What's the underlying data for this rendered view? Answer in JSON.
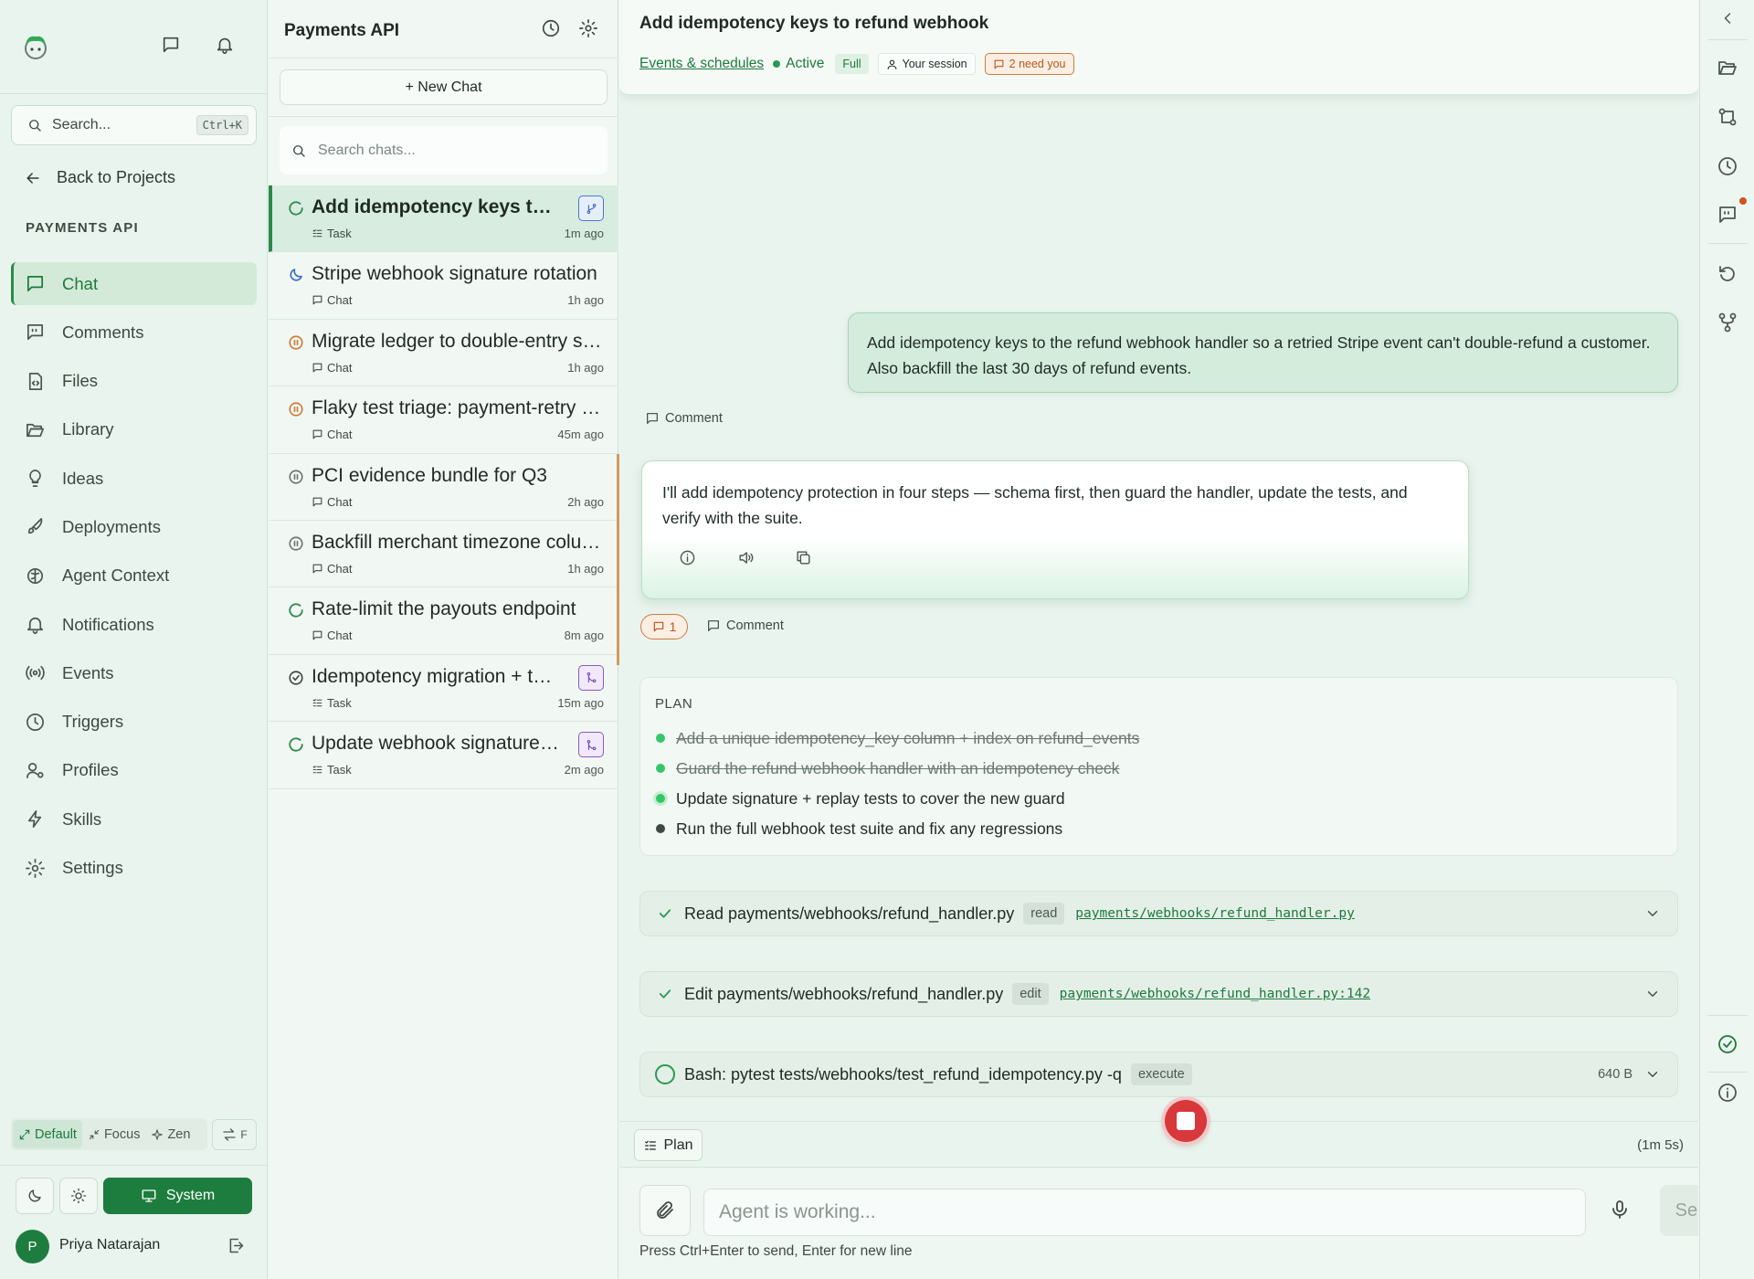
{
  "sidebar": {
    "search_label": "Search...",
    "search_shortcut": "Ctrl+K",
    "back_label": "Back to Projects",
    "project_name": "PAYMENTS API",
    "nav": [
      {
        "label": "Chat",
        "icon": "chat-icon",
        "active": true
      },
      {
        "label": "Comments",
        "icon": "comments-icon"
      },
      {
        "label": "Files",
        "icon": "file-code-icon"
      },
      {
        "label": "Library",
        "icon": "folder-open-icon"
      },
      {
        "label": "Ideas",
        "icon": "lightbulb-icon"
      },
      {
        "label": "Deployments",
        "icon": "rocket-icon"
      },
      {
        "label": "Agent Context",
        "icon": "brain-icon"
      },
      {
        "label": "Notifications",
        "icon": "bell-icon"
      },
      {
        "label": "Events",
        "icon": "broadcast-icon"
      },
      {
        "label": "Triggers",
        "icon": "clock-icon"
      },
      {
        "label": "Profiles",
        "icon": "user-gear-icon"
      },
      {
        "label": "Skills",
        "icon": "lightning-icon"
      },
      {
        "label": "Settings",
        "icon": "gear-icon"
      }
    ],
    "layout_modes": [
      "Default",
      "Focus",
      "Zen"
    ],
    "layout_active": "Default",
    "swap_label": "F",
    "theme_system_label": "System",
    "user": {
      "initial": "P",
      "name": "Priya Natarajan"
    }
  },
  "chatlist": {
    "title": "Payments API",
    "new_chat_label": "+ New Chat",
    "search_placeholder": "Search chats...",
    "items": [
      {
        "title": "Add idempotency keys to refund webhook",
        "kind": "Task",
        "time": "1m ago",
        "status": "running",
        "badge": "branch-blue",
        "active": true
      },
      {
        "title": "Stripe webhook signature rotation",
        "kind": "Chat",
        "time": "1h ago",
        "status": "moon"
      },
      {
        "title": "Migrate ledger to double-entry schema",
        "kind": "Chat",
        "time": "1h ago",
        "status": "paused-orange"
      },
      {
        "title": "Flaky test triage: payment-retry suite",
        "kind": "Chat",
        "time": "45m ago",
        "status": "paused-orange"
      },
      {
        "title": "PCI evidence bundle for Q3",
        "kind": "Chat",
        "time": "2h ago",
        "status": "paused-gray"
      },
      {
        "title": "Backfill merchant timezone column",
        "kind": "Chat",
        "time": "1h ago",
        "status": "paused-gray"
      },
      {
        "title": "Rate-limit the payouts endpoint",
        "kind": "Chat",
        "time": "8m ago",
        "status": "running"
      },
      {
        "title": "Idempotency migration + tests",
        "kind": "Task",
        "time": "15m ago",
        "status": "done",
        "badge": "merge-purple"
      },
      {
        "title": "Update webhook signature tests",
        "kind": "Task",
        "time": "2m ago",
        "status": "running",
        "badge": "merge-purple"
      }
    ]
  },
  "main": {
    "title": "Add idempotency keys to refund webhook",
    "events_link": "Events & schedules",
    "status": "Active",
    "mode_badge": "Full",
    "session_badge": "Your session",
    "need_badge": "2 need you",
    "user_message": "Add idempotency keys to the refund webhook handler so a retried Stripe event can't double-refund a customer. Also backfill the last 30 days of refund events.",
    "comment_label": "Comment",
    "agent_message": "I'll add idempotency protection in four steps — schema first, then guard the handler, update the tests, and verify with the suite.",
    "comment_count": "1",
    "plan": {
      "title": "PLAN",
      "steps": [
        {
          "text": "Add a unique idempotency_key column + index on refund_events",
          "state": "done"
        },
        {
          "text": "Guard the refund webhook handler with an idempotency check",
          "state": "done"
        },
        {
          "text": "Update signature + replay tests to cover the new guard",
          "state": "current"
        },
        {
          "text": "Run the full webhook test suite and fix any regressions",
          "state": "pending"
        }
      ]
    },
    "tools": [
      {
        "label": "Read payments/webhooks/refund_handler.py",
        "tag": "read",
        "path": "payments/webhooks/refund_handler.py",
        "state": "done",
        "size": ""
      },
      {
        "label": "Edit payments/webhooks/refund_handler.py",
        "tag": "edit",
        "path": "payments/webhooks/refund_handler.py:142",
        "state": "done",
        "size": ""
      },
      {
        "label": "Bash: pytest tests/webhooks/test_refund_idempotency.py -q",
        "tag": "execute",
        "path": "",
        "state": "running",
        "size": "640 B"
      }
    ],
    "plan_button": "Plan",
    "elapsed": "(1m 5s)",
    "input_placeholder": "Agent is working...",
    "send_label": "Send",
    "hint": "Press Ctrl+Enter to send, Enter for new line"
  },
  "colors": {
    "accent": "#1d7d3e",
    "accent_light": "#d3ead9",
    "warning": "#d17a3a",
    "stop": "#d8373b",
    "branch_blue": "#3b6bc7",
    "merge_purple": "#7a48b8"
  }
}
